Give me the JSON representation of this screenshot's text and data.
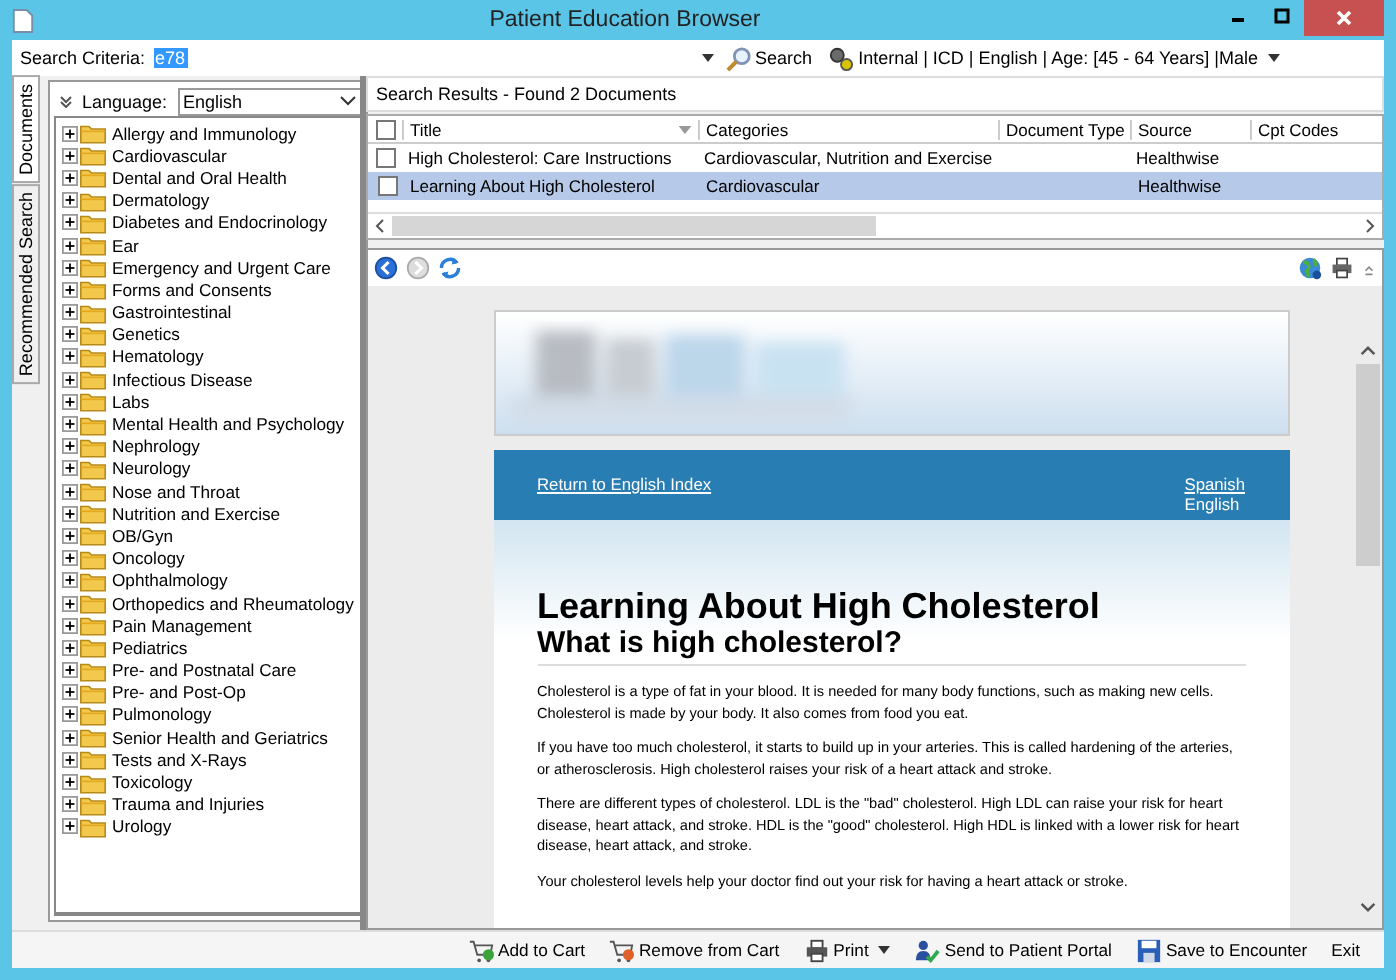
{
  "window": {
    "title": "Patient Education Browser"
  },
  "search": {
    "label": "Search Criteria:",
    "value": "e78",
    "button": "Search",
    "criteria": "Internal | ICD | English | Age: [45 - 64 Years] |Male"
  },
  "side_tabs": [
    {
      "label": "Documents",
      "selected": true
    },
    {
      "label": "Recommended Search",
      "selected": false
    }
  ],
  "language": {
    "label": "Language:",
    "value": "English"
  },
  "tree": [
    {
      "label": "Allergy and Immunology",
      "expanded": false
    },
    {
      "label": "Cardiovascular",
      "expanded": false
    },
    {
      "label": "Dental and Oral Health",
      "expanded": false
    },
    {
      "label": "Dermatology",
      "expanded": false
    },
    {
      "label": "Diabetes and Endocrinology",
      "expanded": false
    },
    {
      "label": "Ear",
      "expanded": false
    },
    {
      "label": "Emergency and Urgent Care",
      "expanded": false
    },
    {
      "label": "Forms and Consents",
      "expanded": false
    },
    {
      "label": "Gastrointestinal",
      "expanded": false
    },
    {
      "label": "Genetics",
      "expanded": false
    },
    {
      "label": "Hematology",
      "expanded": false
    },
    {
      "label": "Infectious Disease",
      "expanded": false
    },
    {
      "label": "Labs",
      "expanded": false
    },
    {
      "label": "Mental Health and Psychology",
      "expanded": false
    },
    {
      "label": "Nephrology",
      "expanded": false
    },
    {
      "label": "Neurology",
      "expanded": false
    },
    {
      "label": "Nose and Throat",
      "expanded": false
    },
    {
      "label": "Nutrition and Exercise",
      "expanded": false
    },
    {
      "label": "OB/Gyn",
      "expanded": false
    },
    {
      "label": "Oncology",
      "expanded": false
    },
    {
      "label": "Ophthalmology",
      "expanded": false
    },
    {
      "label": "Orthopedics and Rheumatology",
      "expanded": false
    },
    {
      "label": "Pain Management",
      "expanded": false
    },
    {
      "label": "Pediatrics",
      "expanded": false
    },
    {
      "label": "Pre- and Postnatal Care",
      "expanded": false
    },
    {
      "label": "Pre- and Post-Op",
      "expanded": false
    },
    {
      "label": "Pulmonology",
      "expanded": false
    },
    {
      "label": "Senior Health and Geriatrics",
      "expanded": false
    },
    {
      "label": "Tests and X-Rays",
      "expanded": false
    },
    {
      "label": "Toxicology",
      "expanded": false
    },
    {
      "label": "Trauma and Injuries",
      "expanded": false
    },
    {
      "label": "Urology",
      "expanded": false
    }
  ],
  "results": {
    "heading": "Search Results - Found 2 Documents",
    "select_all": {
      "checked": false
    },
    "columns": [
      "Title",
      "Categories",
      "Document Type",
      "Source",
      "Cpt Codes"
    ],
    "rows": [
      {
        "cells": [
          "High Cholesterol: Care Instructions",
          "Cardiovascular, Nutrition and Exercise",
          "",
          "Healthwise",
          ""
        ],
        "checked": false,
        "selected": false
      },
      {
        "cells": [
          "Learning About High Cholesterol",
          "Cardiovascular",
          "",
          "Healthwise",
          ""
        ],
        "checked": false,
        "selected": true
      }
    ]
  },
  "document": {
    "nav_link": "Return to English Index",
    "languages": [
      {
        "label": "Spanish",
        "kind": "link"
      },
      {
        "label": "English",
        "kind": "current"
      }
    ],
    "title": "Learning About High Cholesterol",
    "subtitle": "What is high cholesterol?",
    "paragraphs": [
      "Cholesterol is a type of fat in your blood. It is needed for many body functions, such as making new cells. Cholesterol is made by your body. It also comes from food you eat.",
      "If you have too much cholesterol, it starts to build up in your arteries. This is called hardening of the arteries, or atherosclerosis. High cholesterol raises your risk of a heart attack and stroke.",
      "There are different types of cholesterol. LDL is the \"bad\" cholesterol. High LDL can raise your risk for heart disease, heart attack, and stroke. HDL is the \"good\" cholesterol. High HDL is linked with a lower risk for heart disease, heart attack, and stroke.",
      "Your cholesterol levels help your doctor find out your risk for having a heart attack or stroke."
    ]
  },
  "actions": [
    {
      "label": "Add to Cart",
      "kind": "add"
    },
    {
      "label": "Remove from Cart",
      "kind": "remove"
    },
    {
      "label": "Print",
      "kind": "print"
    },
    {
      "label": "Send to Patient Portal",
      "kind": "portal"
    },
    {
      "label": "Save to Encounter",
      "kind": "save"
    },
    {
      "label": "Exit",
      "kind": "exit"
    }
  ]
}
